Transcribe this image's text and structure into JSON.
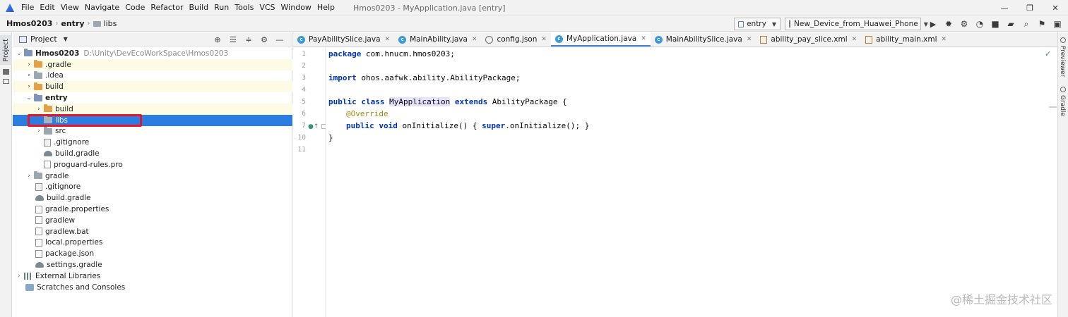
{
  "menubar": {
    "items": [
      "File",
      "Edit",
      "View",
      "Navigate",
      "Code",
      "Refactor",
      "Build",
      "Run",
      "Tools",
      "VCS",
      "Window",
      "Help"
    ],
    "window_title": "Hmos0203 - MyApplication.java [entry]",
    "controls": {
      "minimize": "—",
      "restore": "❐",
      "close": "✕"
    }
  },
  "breadcrumb": {
    "items": [
      "Hmos0203",
      "entry",
      "libs"
    ]
  },
  "toolbar": {
    "module_select": "entry",
    "device_select": "New_Device_from_Huawei_Phone",
    "icons": [
      "run-icon",
      "debug-icon",
      "attach-debugger-icon",
      "profile-icon",
      "stop-icon",
      "sync-icon",
      "project-structure-icon",
      "search-icon",
      "build-icon",
      "hidden-icon"
    ]
  },
  "left_stripe": {
    "project_tab": "Project"
  },
  "project_panel": {
    "title": "Project",
    "tree": [
      {
        "label": "Hmos0203",
        "path": "D:\\Unity\\DevEcoWorkSpace\\Hmos0203"
      },
      {
        "label": ".gradle"
      },
      {
        "label": ".idea"
      },
      {
        "label": "build"
      },
      {
        "label": "entry"
      },
      {
        "label": "build"
      },
      {
        "label": "libs"
      },
      {
        "label": "src"
      },
      {
        "label": ".gitignore"
      },
      {
        "label": "build.gradle"
      },
      {
        "label": "proguard-rules.pro"
      },
      {
        "label": "gradle"
      },
      {
        "label": ".gitignore"
      },
      {
        "label": "build.gradle"
      },
      {
        "label": "gradle.properties"
      },
      {
        "label": "gradlew"
      },
      {
        "label": "gradlew.bat"
      },
      {
        "label": "local.properties"
      },
      {
        "label": "package.json"
      },
      {
        "label": "settings.gradle"
      },
      {
        "label": "External Libraries"
      },
      {
        "label": "Scratches and Consoles"
      }
    ]
  },
  "tabs": [
    {
      "label": "PayAbilitySlice.java",
      "icon": "class-icon"
    },
    {
      "label": "MainAbility.java",
      "icon": "class-icon"
    },
    {
      "label": "config.json",
      "icon": "json-icon"
    },
    {
      "label": "MyApplication.java",
      "icon": "class-icon",
      "active": true
    },
    {
      "label": "MainAbilitySlice.java",
      "icon": "class-icon"
    },
    {
      "label": "ability_pay_slice.xml",
      "icon": "xml-icon"
    },
    {
      "label": "ability_main.xml",
      "icon": "xml-icon"
    }
  ],
  "editor": {
    "line_numbers": [
      "1",
      "2",
      "3",
      "4",
      "5",
      "6",
      "7",
      "10",
      "11"
    ],
    "code": {
      "l1_kw": "package",
      "l1_rest": " com.hnucm.hmos0203;",
      "l3_kw": "import",
      "l3_rest": " ohos.aafwk.ability.AbilityPackage;",
      "l5_kw1": "public class",
      "l5_ident": "MyApplication",
      "l5_kw2": "extends",
      "l5_rest": " AbilityPackage {",
      "l6_ann": "@Override",
      "l7_kw1": "public void",
      "l7_mid": " onInitialize() { ",
      "l7_kw2": "super",
      "l7_rest": ".onInitialize(); }",
      "l10": "}"
    }
  },
  "right_stripe": {
    "previewer": "Previewer",
    "gradle": "Gradle"
  },
  "watermark": "@稀土掘金技术社区",
  "colors": {
    "selection": "#2b7de1",
    "highlight_box": "#e4172b",
    "keyword": "#0033b3",
    "annotation": "#9e880d"
  }
}
